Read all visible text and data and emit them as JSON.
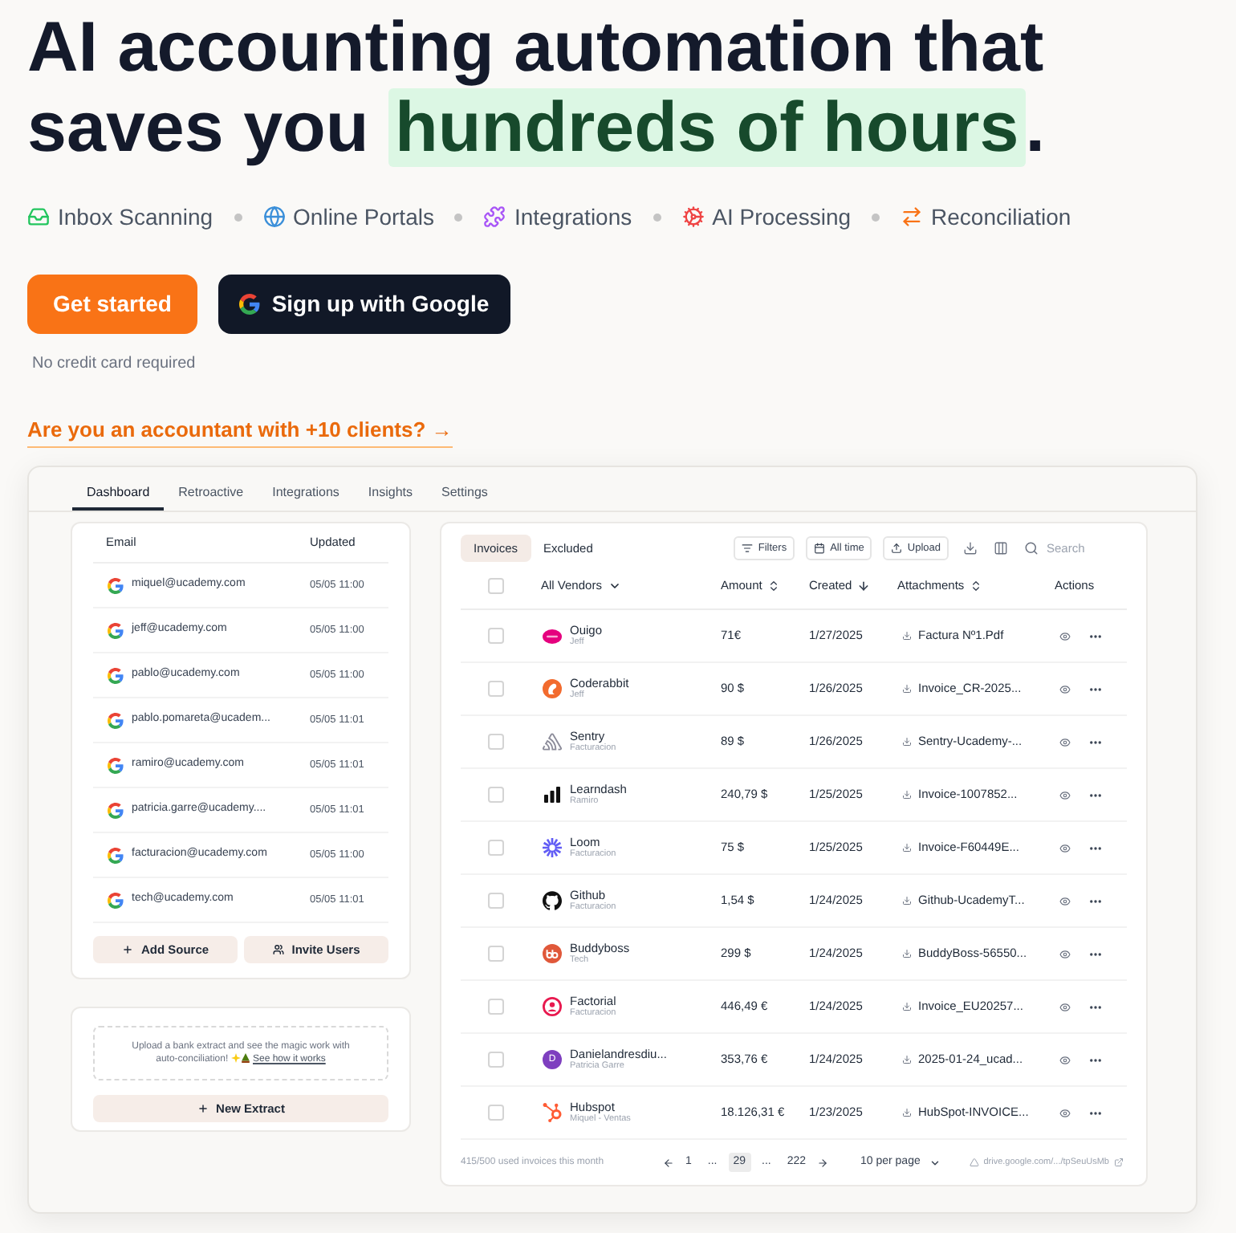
{
  "headline": {
    "before": "AI accounting automation that saves you",
    "highlight": "hundreds of hours",
    "after": "."
  },
  "features": [
    {
      "label": "Inbox Scanning",
      "color": "#22c55e"
    },
    {
      "label": "Online Portals",
      "color": "#3b8fd9"
    },
    {
      "label": "Integrations",
      "color": "#a855f7"
    },
    {
      "label": "AI Processing",
      "color": "#ef4444"
    },
    {
      "label": "Reconciliation",
      "color": "#f97316"
    }
  ],
  "buttons": [
    {
      "label": "Get started",
      "kind": "primary"
    },
    {
      "label": "Sign up with Google",
      "kind": "google"
    }
  ],
  "note": "No credit card required",
  "accountant_link": "Are you an accountant with +10 clients? →",
  "dashboard": {
    "tabs": [
      {
        "label": "Dashboard",
        "selected": true
      },
      {
        "label": "Retroactive",
        "selected": false
      },
      {
        "label": "Integrations",
        "selected": false
      },
      {
        "label": "Insights",
        "selected": false
      },
      {
        "label": "Settings",
        "selected": false
      }
    ],
    "sources": {
      "columns": [
        "Email",
        "Updated"
      ],
      "rows": [
        {
          "email": "miquel@ucademy.com",
          "updated": "05/05 11:00"
        },
        {
          "email": "jeff@ucademy.com",
          "updated": "05/05 11:00"
        },
        {
          "email": "pablo@ucademy.com",
          "updated": "05/05 11:00"
        },
        {
          "email": "pablo.pomareta@ucadem...",
          "updated": "05/05 11:01"
        },
        {
          "email": "ramiro@ucademy.com",
          "updated": "05/05 11:01"
        },
        {
          "email": "patricia.garre@ucademy....",
          "updated": "05/05 11:01"
        },
        {
          "email": "facturacion@ucademy.com",
          "updated": "05/05 11:00"
        },
        {
          "email": "tech@ucademy.com",
          "updated": "05/05 11:01"
        }
      ],
      "actions": [
        "Add Source",
        "Invite Users"
      ]
    },
    "extract": {
      "text": "Upload a bank extract and see the magic work with auto-conciliation!",
      "link": "See how it works",
      "button": "New Extract"
    },
    "invoices": {
      "tabs": [
        {
          "label": "Invoices",
          "selected": true
        },
        {
          "label": "Excluded",
          "selected": false
        }
      ],
      "toolbar": [
        "Filters",
        "All time",
        "Upload"
      ],
      "search": {
        "placeholder": "Search"
      },
      "select_all": {
        "checked": false
      },
      "columns": [
        {
          "label": "All Vendors",
          "kind": "dropdown"
        },
        {
          "label": "Amount",
          "kind": "sort",
          "sorted": false
        },
        {
          "label": "Created",
          "kind": "sort",
          "sorted": true
        },
        {
          "label": "Attachments",
          "kind": "sort",
          "sorted": false
        },
        {
          "label": "Actions",
          "kind": "plain"
        }
      ],
      "rows": [
        {
          "vendor": "Ouigo",
          "account": "Jeff",
          "amount": "71€",
          "created": "1/27/2025",
          "attachment": "Factura Nº1.Pdf",
          "checked": false
        },
        {
          "vendor": "Coderabbit",
          "account": "Jeff",
          "amount": "90 $",
          "created": "1/26/2025",
          "attachment": "Invoice_CR-2025...",
          "checked": false
        },
        {
          "vendor": "Sentry",
          "account": "Facturacion",
          "amount": "89 $",
          "created": "1/26/2025",
          "attachment": "Sentry-Ucademy-...",
          "checked": false
        },
        {
          "vendor": "Learndash",
          "account": "Ramiro",
          "amount": "240,79 $",
          "created": "1/25/2025",
          "attachment": "Invoice-1007852...",
          "checked": false
        },
        {
          "vendor": "Loom",
          "account": "Facturacion",
          "amount": "75 $",
          "created": "1/25/2025",
          "attachment": "Invoice-F60449E...",
          "checked": false
        },
        {
          "vendor": "Github",
          "account": "Facturacion",
          "amount": "1,54 $",
          "created": "1/24/2025",
          "attachment": "Github-UcademyT...",
          "checked": false
        },
        {
          "vendor": "Buddyboss",
          "account": "Tech",
          "amount": "299 $",
          "created": "1/24/2025",
          "attachment": "BuddyBoss-56550...",
          "checked": false
        },
        {
          "vendor": "Factorial",
          "account": "Facturacion",
          "amount": "446,49 €",
          "created": "1/24/2025",
          "attachment": "Invoice_EU20257...",
          "checked": false
        },
        {
          "vendor": "Danielandresdiu...",
          "account": "Patricia Garre",
          "avatar": "D",
          "amount": "353,76 €",
          "created": "1/24/2025",
          "attachment": "2025-01-24_ucad...",
          "checked": false
        },
        {
          "vendor": "Hubspot",
          "account": "Miquel - Ventas",
          "amount": "18.126,31 €",
          "created": "1/23/2025",
          "attachment": "HubSpot-INVOICE...",
          "checked": false
        }
      ],
      "usage": "415/500 used invoices this month",
      "pages": [
        {
          "label": "1",
          "selected": false
        },
        {
          "label": "...",
          "selected": false
        },
        {
          "label": "29",
          "selected": true
        },
        {
          "label": "...",
          "selected": false
        },
        {
          "label": "222",
          "selected": false
        }
      ],
      "per_page": "10 per page",
      "drive_link": "drive.google.com/.../tpSeuUsMb"
    }
  }
}
